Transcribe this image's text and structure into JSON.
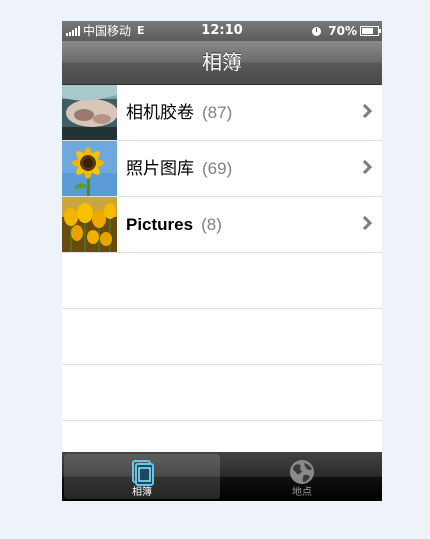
{
  "status_bar": {
    "carrier": "中国移动",
    "network": "E",
    "time": "12:10",
    "battery": "70%",
    "battery_level": 0.7
  },
  "nav": {
    "title": "相簿"
  },
  "albums": [
    {
      "name": "相机胶卷",
      "count": "(87)"
    },
    {
      "name": "照片图库",
      "count": "(69)"
    },
    {
      "name": "Pictures",
      "count": "(8)"
    }
  ],
  "tabs": [
    {
      "label": "相簿",
      "icon": "albums-icon",
      "selected": true
    },
    {
      "label": "地点",
      "icon": "globe-icon",
      "selected": false
    }
  ],
  "colors": {
    "tab_icon_selected": "#5fc8ef",
    "count_gray": "#808080"
  }
}
